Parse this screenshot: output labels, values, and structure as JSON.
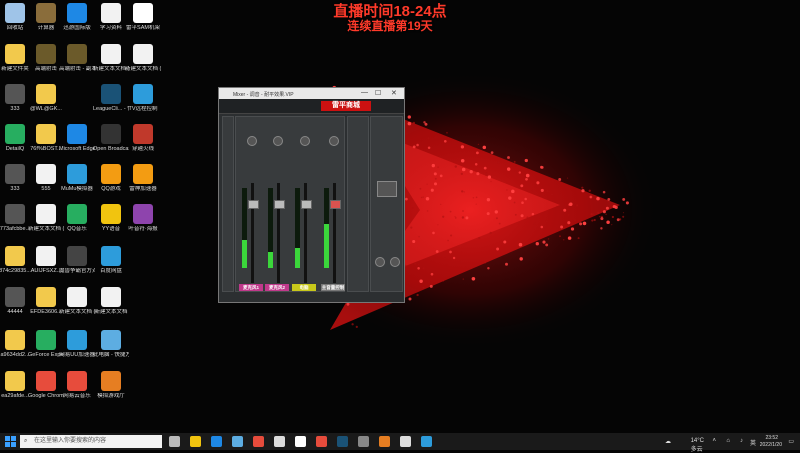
{
  "overlay": {
    "line1": "直播时间18-24点",
    "line2": "连续直播第19天"
  },
  "desktop_icons": [
    {
      "label": "回收站",
      "color": "#9fc4e8"
    },
    {
      "label": "计算器",
      "color": "#8a6d3b"
    },
    {
      "label": "迅游国际版",
      "color": "#1e88e5"
    },
    {
      "label": "学习资料",
      "color": "#f2f2f2"
    },
    {
      "label": "雷平SAM机架",
      "color": "#ffffff"
    },
    {
      "label": "新建文件夹",
      "color": "#f2c94c"
    },
    {
      "label": "高端射击",
      "color": "#6b5a2a"
    },
    {
      "label": "高端射击 - 副本",
      "color": "#6b5a2a"
    },
    {
      "label": "新建文本文档 (2)",
      "color": "#f2f2f2"
    },
    {
      "label": "新建文本文档 (5)",
      "color": "#f2f2f2"
    },
    {
      "label": "333",
      "color": "#555555"
    },
    {
      "label": "@WL@GK...",
      "color": "#f2c94c"
    },
    {
      "label": "LeagueCli... - 快捷方式",
      "color": "#1a5276"
    },
    {
      "label": "TV远程控制",
      "color": "#2d9cdb"
    },
    {
      "label": "DetailQ",
      "color": "#27ae60"
    },
    {
      "label": "76f%BOST...",
      "color": "#f2c94c"
    },
    {
      "label": "Microsoft Edge",
      "color": "#1e88e5"
    },
    {
      "label": "Open Broadcast...",
      "color": "#333333"
    },
    {
      "label": "穿越火线",
      "color": "#c0392b"
    },
    {
      "label": "333",
      "color": "#555555"
    },
    {
      "label": "555",
      "color": "#f2f2f2"
    },
    {
      "label": "MuMu模拟器",
      "color": "#2d9cdb"
    },
    {
      "label": "QQ游戏",
      "color": "#f39c12"
    },
    {
      "label": "雷神加速器",
      "color": "#f39c12"
    },
    {
      "label": "773afcbbe...",
      "color": "#555555"
    },
    {
      "label": "新建文本文档 (3)",
      "color": "#f2f2f2"
    },
    {
      "label": "QQ音乐",
      "color": "#27ae60"
    },
    {
      "label": "YY语音",
      "color": "#f1c40f"
    },
    {
      "label": "叶音符·海报",
      "color": "#8e44ad"
    },
    {
      "label": "874c29835...",
      "color": "#f2c94c"
    },
    {
      "label": "AUIJFSXZ...",
      "color": "#f2f2f2"
    },
    {
      "label": "魔兽争霸官方对战平台",
      "color": "#444444"
    },
    {
      "label": "百度网盘",
      "color": "#2d9cdb"
    },
    {
      "label": "44444",
      "color": "#555555"
    },
    {
      "label": "EFDE3606...",
      "color": "#f2c94c"
    },
    {
      "label": "新建文本文档 (4)",
      "color": "#f2f2f2"
    },
    {
      "label": "新建文本文档",
      "color": "#f2f2f2"
    },
    {
      "label": "a9634dd2...",
      "color": "#f2c94c"
    },
    {
      "label": "GeForce Experience",
      "color": "#27ae60"
    },
    {
      "label": "网易UU加速器",
      "color": "#2d9cdb"
    },
    {
      "label": "此电脑 - 快捷方式",
      "color": "#5dade2"
    },
    {
      "label": "ea29afde...",
      "color": "#f2c94c"
    },
    {
      "label": "Google Chrome",
      "color": "#e74c3c"
    },
    {
      "label": "网易云音乐",
      "color": "#e74c3c"
    },
    {
      "label": "模拟游戏厅",
      "color": "#e67e22"
    }
  ],
  "mixer": {
    "title": "Mixer - 调音 - 耐平效果.VIP",
    "logo": "雷平商城",
    "channels": [
      {
        "label": "麦克风1",
        "color": "#c0398b",
        "level": 0.35
      },
      {
        "label": "麦克风2",
        "color": "#c0398b",
        "level": 0.2
      },
      {
        "label": "电脑",
        "color": "#c8c81a",
        "level": 0.25
      },
      {
        "label": "主音量控制",
        "color": "#777777",
        "level": 0.55
      }
    ],
    "close_glyph": "✕",
    "minimize_glyph": "—",
    "maximize_glyph": "☐"
  },
  "taskbar": {
    "search_placeholder": "在这里输入你要搜索的内容",
    "apps": [
      "#bbbbbb",
      "#f1c40f",
      "#1e88e5",
      "#5dade2",
      "#e74c3c",
      "#dddddd",
      "#ffffff",
      "#e74c3c",
      "#1a5276",
      "#888888",
      "#e67e22",
      "#dddddd",
      "#2d9cdb"
    ],
    "weather": "14°C 多云",
    "time": "23:52",
    "date": "2022/1/20"
  }
}
